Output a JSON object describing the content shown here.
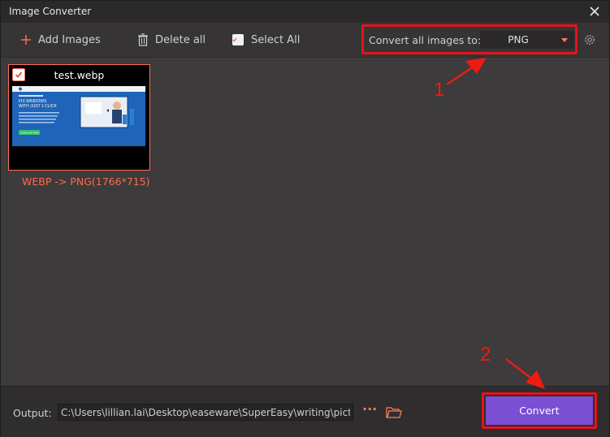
{
  "window": {
    "title": "Image Converter"
  },
  "toolbar": {
    "add_images": "Add Images",
    "delete_all": "Delete all",
    "select_all": "Select All",
    "convert_all_label": "Convert all images to:",
    "format_value": "PNG"
  },
  "image_item": {
    "filename": "test.webp",
    "conversion": "WEBP -> PNG(1766*715)",
    "checked": true,
    "preview": {
      "headline_1": "FIX WINDOWS",
      "headline_2": "WITH JUST 1 CLICK",
      "button_label": "DOWNLOAD FREE"
    }
  },
  "bottom": {
    "output_label": "Output:",
    "output_path": "C:\\Users\\lillian.lai\\Desktop\\easeware\\SuperEasy\\writing\\pictures\\br",
    "more": "···",
    "convert": "Convert"
  },
  "annotations": {
    "step1": "1",
    "step2": "2"
  },
  "colors": {
    "accent": "#ff6f52",
    "highlight": "#e8111a",
    "convert_button": "#7a4fd3",
    "background": "#3d3b3b"
  },
  "icons": [
    "close-icon",
    "plus-icon",
    "trash-icon",
    "checkbox-icon",
    "chevron-down-icon",
    "gear-icon",
    "ellipsis-icon",
    "folder-icon"
  ]
}
